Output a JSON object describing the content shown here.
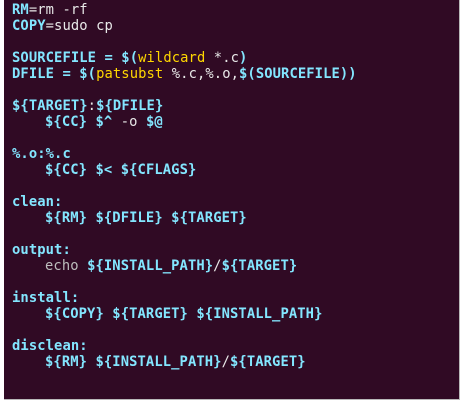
{
  "colors": {
    "background": "#300a24",
    "plain": "#e8e8e8",
    "variable": "#83e6ff",
    "target_name": "#83e6ff",
    "function": "#ffd700",
    "command": "#bdbdbd"
  },
  "lines": [
    {
      "indent": false,
      "segments": [
        {
          "text": "RM",
          "style": "variable"
        },
        {
          "text": "=rm -rf",
          "style": "plain"
        }
      ]
    },
    {
      "indent": false,
      "segments": [
        {
          "text": "COPY",
          "style": "variable"
        },
        {
          "text": "=sudo cp",
          "style": "plain"
        }
      ]
    },
    {
      "blank": true
    },
    {
      "indent": false,
      "segments": [
        {
          "text": "SOURCEFILE = $(",
          "style": "variable"
        },
        {
          "text": "wildcard",
          "style": "function"
        },
        {
          "text": " *.c",
          "style": "plain"
        },
        {
          "text": ")",
          "style": "variable"
        }
      ]
    },
    {
      "indent": false,
      "segments": [
        {
          "text": "DFILE = $(",
          "style": "variable"
        },
        {
          "text": "patsubst",
          "style": "function"
        },
        {
          "text": " %.c,%.o,",
          "style": "plain"
        },
        {
          "text": "$(SOURCEFILE))",
          "style": "variable"
        }
      ]
    },
    {
      "blank": true
    },
    {
      "indent": false,
      "segments": [
        {
          "text": "${TARGET}",
          "style": "variable"
        },
        {
          "text": ":",
          "style": "plain"
        },
        {
          "text": "${DFILE}",
          "style": "variable"
        }
      ]
    },
    {
      "indent": true,
      "segments": [
        {
          "text": "${CC}",
          "style": "variable"
        },
        {
          "text": " ",
          "style": "plain"
        },
        {
          "text": "$^",
          "style": "variable"
        },
        {
          "text": " -o ",
          "style": "plain"
        },
        {
          "text": "$@",
          "style": "variable"
        }
      ]
    },
    {
      "blank": true
    },
    {
      "indent": false,
      "segments": [
        {
          "text": "%.o:%.c",
          "style": "variable"
        }
      ]
    },
    {
      "indent": true,
      "segments": [
        {
          "text": "${CC}",
          "style": "variable"
        },
        {
          "text": " ",
          "style": "plain"
        },
        {
          "text": "$<",
          "style": "variable"
        },
        {
          "text": " ",
          "style": "plain"
        },
        {
          "text": "${CFLAGS}",
          "style": "variable"
        }
      ]
    },
    {
      "blank": true
    },
    {
      "indent": false,
      "segments": [
        {
          "text": "clean:",
          "style": "target_name"
        }
      ]
    },
    {
      "indent": true,
      "segments": [
        {
          "text": "${RM}",
          "style": "variable"
        },
        {
          "text": " ",
          "style": "plain"
        },
        {
          "text": "${DFILE}",
          "style": "variable"
        },
        {
          "text": " ",
          "style": "plain"
        },
        {
          "text": "${TARGET}",
          "style": "variable"
        }
      ]
    },
    {
      "blank": true
    },
    {
      "indent": false,
      "segments": [
        {
          "text": "output:",
          "style": "target_name"
        }
      ]
    },
    {
      "indent": true,
      "segments": [
        {
          "text": "echo",
          "style": "command"
        },
        {
          "text": " ",
          "style": "plain"
        },
        {
          "text": "${INSTALL_PATH}",
          "style": "variable"
        },
        {
          "text": "/",
          "style": "plain"
        },
        {
          "text": "${TARGET}",
          "style": "variable"
        }
      ]
    },
    {
      "blank": true
    },
    {
      "indent": false,
      "segments": [
        {
          "text": "install:",
          "style": "target_name"
        }
      ]
    },
    {
      "indent": true,
      "segments": [
        {
          "text": "${COPY}",
          "style": "variable"
        },
        {
          "text": " ",
          "style": "plain"
        },
        {
          "text": "${TARGET}",
          "style": "variable"
        },
        {
          "text": " ",
          "style": "plain"
        },
        {
          "text": "${INSTALL_PATH}",
          "style": "variable"
        }
      ]
    },
    {
      "blank": true
    },
    {
      "indent": false,
      "segments": [
        {
          "text": "disclean:",
          "style": "target_name"
        }
      ]
    },
    {
      "indent": true,
      "segments": [
        {
          "text": "${RM}",
          "style": "variable"
        },
        {
          "text": " ",
          "style": "plain"
        },
        {
          "text": "${INSTALL_PATH}",
          "style": "variable"
        },
        {
          "text": "/",
          "style": "plain"
        },
        {
          "text": "${TARGET}",
          "style": "variable"
        }
      ]
    }
  ]
}
